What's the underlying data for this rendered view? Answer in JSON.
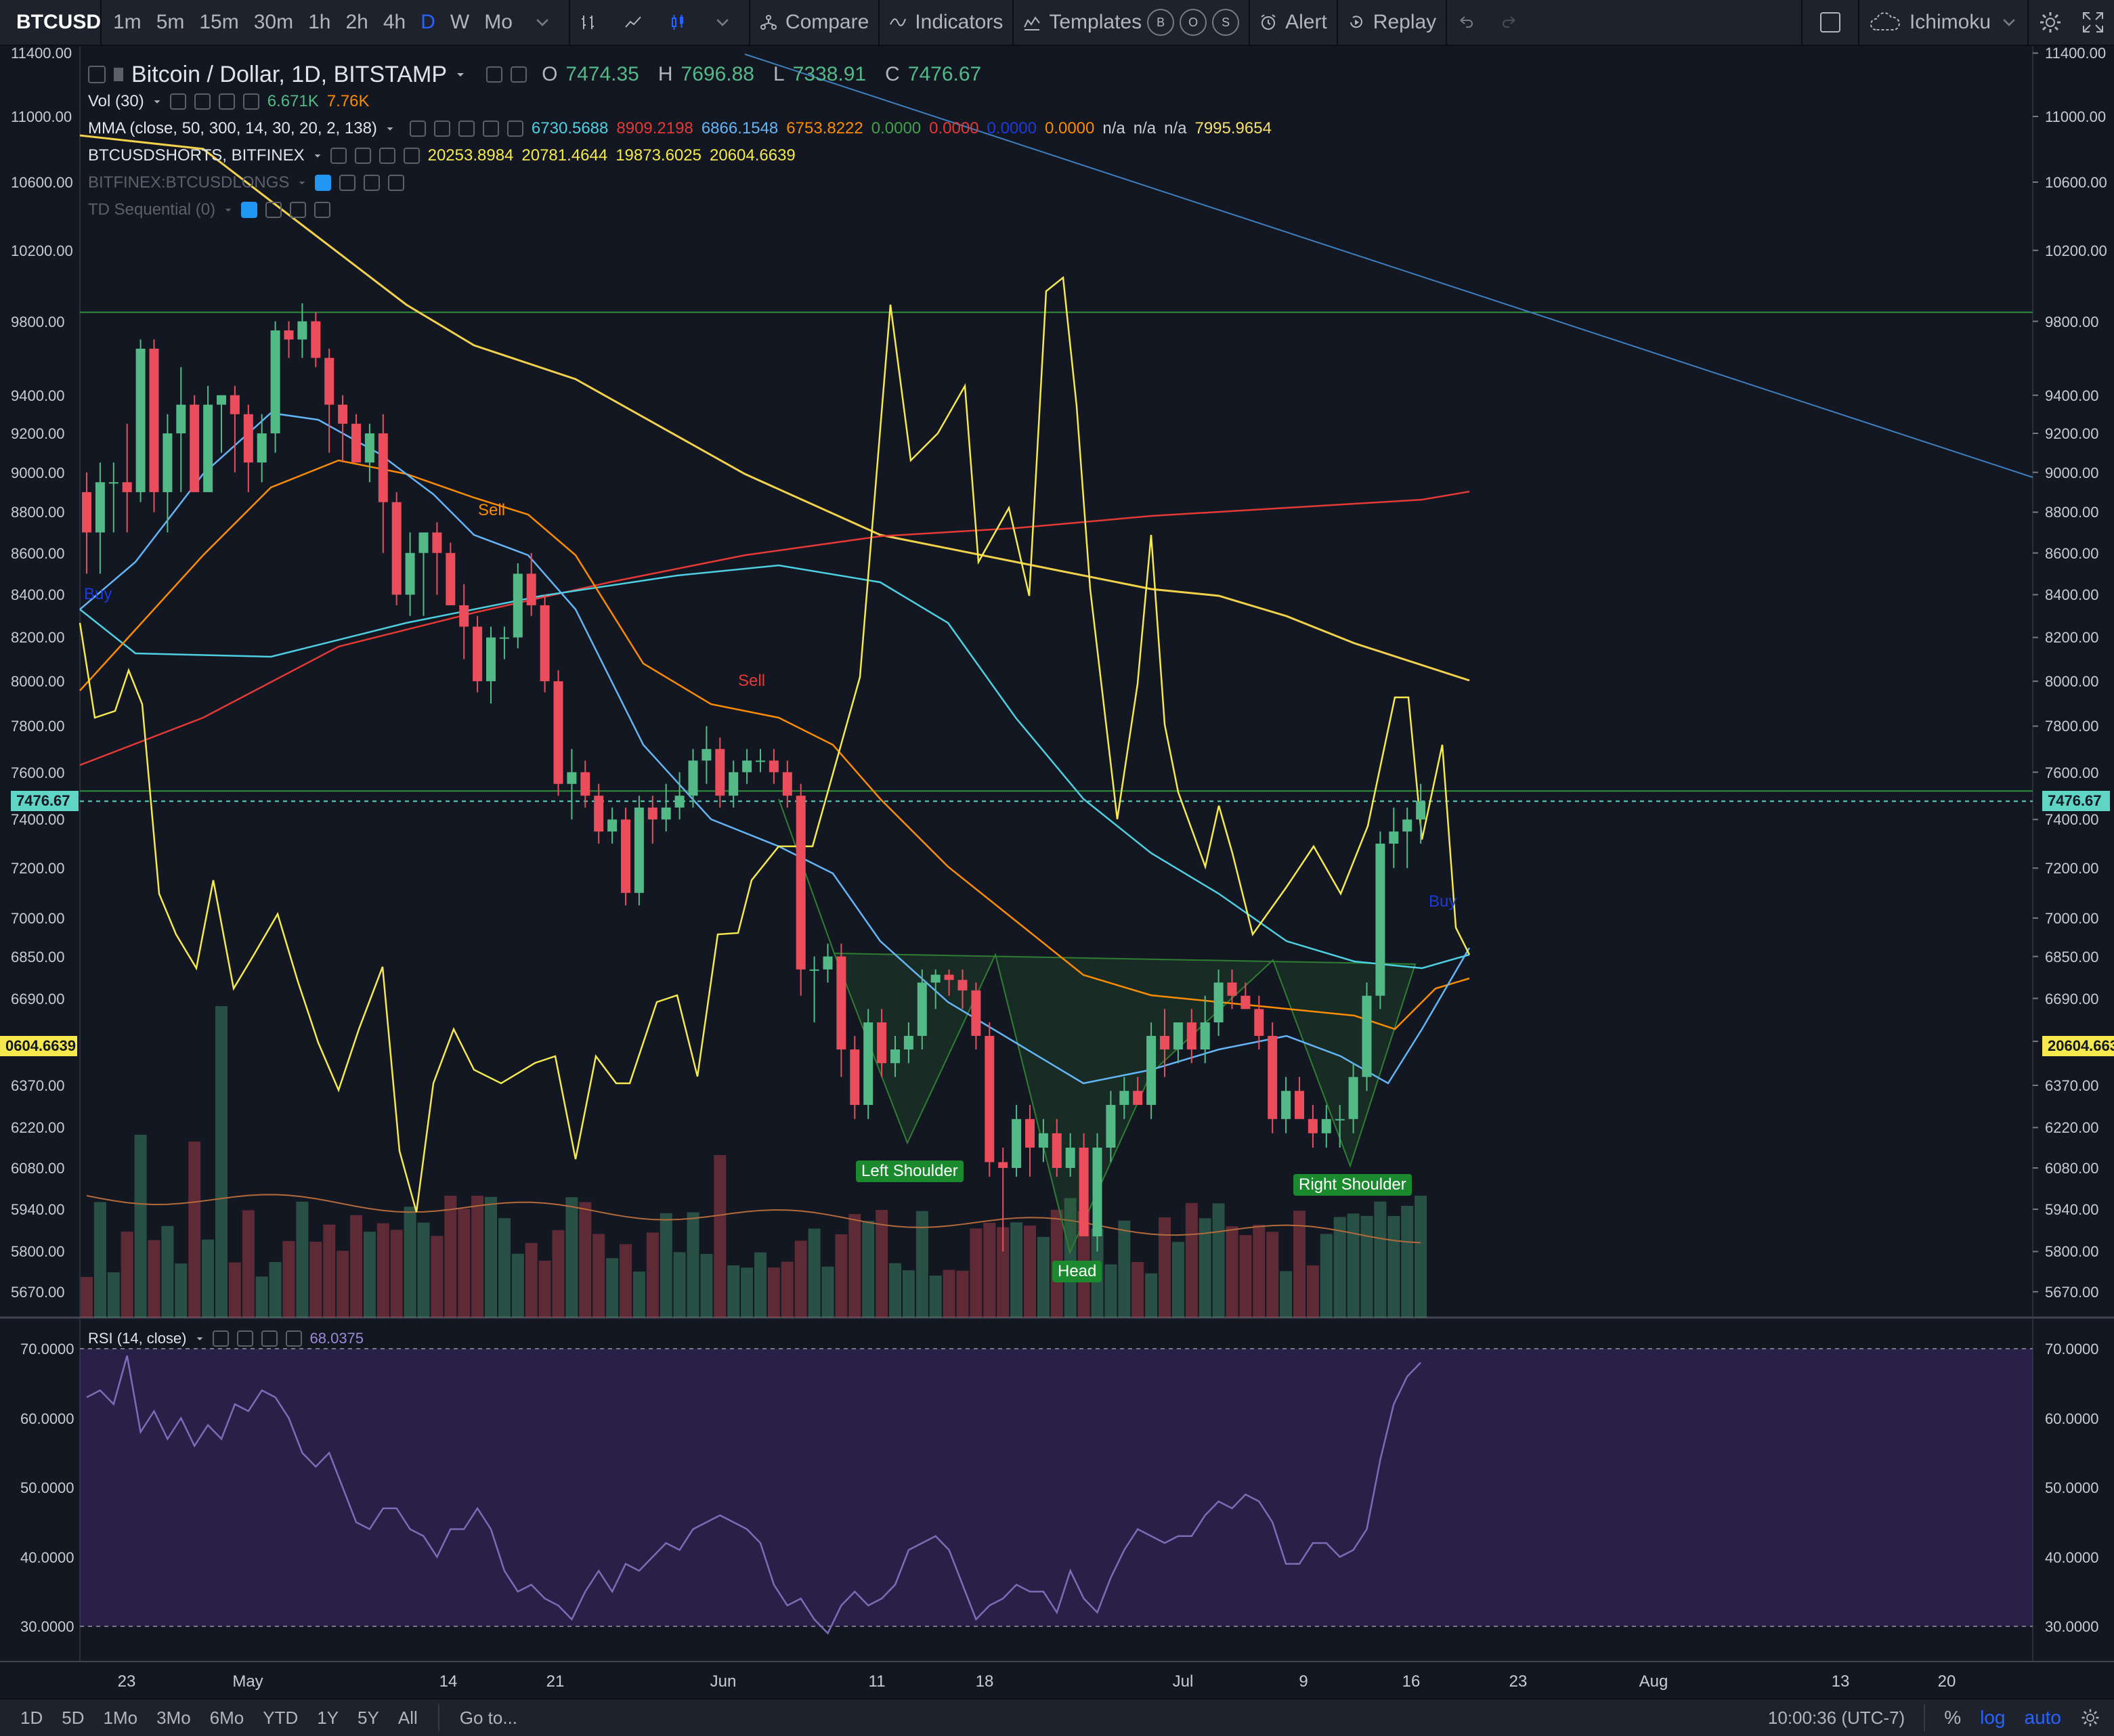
{
  "toolbar": {
    "symbol": "BTCUSD",
    "intervals": [
      "1m",
      "5m",
      "15m",
      "30m",
      "1h",
      "2h",
      "4h",
      "D",
      "W",
      "Mo"
    ],
    "active_interval": "D",
    "compare": "Compare",
    "indicators": "Indicators",
    "templates": "Templates",
    "badges": [
      "B",
      "O",
      "S"
    ],
    "alert": "Alert",
    "replay": "Replay",
    "layout_name": "Ichimoku"
  },
  "legend": {
    "title": "Bitcoin / Dollar, 1D, BITSTAMP",
    "open_k": "O",
    "open": "7474.35",
    "high_k": "H",
    "high": "7696.88",
    "low_k": "L",
    "low": "7338.91",
    "close_k": "C",
    "close": "7476.67",
    "vol_label": "Vol (30)",
    "vol_v1": "6.671K",
    "vol_v2": "7.76K",
    "mma_label": "MMA (close, 50, 300, 14, 30, 20, 2, 138)",
    "mma_values": [
      {
        "v": "6730.5688",
        "c": "#4dd0e1"
      },
      {
        "v": "8909.2198",
        "c": "#e53935"
      },
      {
        "v": "6866.1548",
        "c": "#64b5f6"
      },
      {
        "v": "6753.8222",
        "c": "#fb8c00"
      },
      {
        "v": "0.0000",
        "c": "#43a047"
      },
      {
        "v": "0.0000",
        "c": "#e53935"
      },
      {
        "v": "0.0000",
        "c": "#1e3ad8"
      },
      {
        "v": "0.0000",
        "c": "#fb8c00"
      },
      {
        "v": "n/a",
        "c": "#c8ccd4"
      },
      {
        "v": "n/a",
        "c": "#c8ccd4"
      },
      {
        "v": "n/a",
        "c": "#c8ccd4"
      },
      {
        "v": "7995.9654",
        "c": "#f5e06b"
      }
    ],
    "shorts_label": "BTCUSDSHORTS, BITFINEX",
    "shorts_values": [
      "20253.8984",
      "20781.4644",
      "19873.6025",
      "20604.6639"
    ],
    "longs_label": "BITFINEX:BTCUSDLONGS",
    "td_label": "TD Sequential (0)"
  },
  "price_axis": {
    "ticks": [
      "11400.00",
      "11000.00",
      "10600.00",
      "10200.00",
      "9800.00",
      "9400.00",
      "9200.00",
      "9000.00",
      "8800.00",
      "8600.00",
      "8400.00",
      "8200.00",
      "8000.00",
      "7800.00",
      "7600.00",
      "7400.00",
      "7200.00",
      "7000.00",
      "6850.00",
      "6690.00",
      "6530.00",
      "6370.00",
      "6220.00",
      "6080.00",
      "5940.00",
      "5800.00",
      "5670.00"
    ],
    "current_price": "7476.67",
    "shorts_price_tag": "20604.6639",
    "shorts_price_tag_left": "0604.6639"
  },
  "rsi": {
    "label": "RSI (14, close)",
    "value": "68.0375",
    "ticks": [
      "70.0000",
      "60.0000",
      "50.0000",
      "40.0000",
      "30.0000"
    ]
  },
  "time_axis": [
    "23",
    "May",
    "14",
    "21",
    "Jun",
    "11",
    "18",
    "Jul",
    "9",
    "16",
    "23",
    "Aug",
    "13",
    "20"
  ],
  "annotations": {
    "left_shoulder": "Left Shoulder",
    "head": "Head",
    "right_shoulder": "Right Shoulder",
    "sell1": "Sell",
    "sell2": "Sell",
    "buy1": "Buy",
    "buy2": "Buy"
  },
  "bottombar": {
    "ranges": [
      "1D",
      "5D",
      "1Mo",
      "3Mo",
      "6Mo",
      "YTD",
      "1Y",
      "5Y",
      "All"
    ],
    "goto": "Go to...",
    "time": "10:00:36 (UTC-7)",
    "percent": "%",
    "log": "log",
    "auto": "auto"
  },
  "colors": {
    "bg": "#131722",
    "up": "#53b987",
    "down": "#eb4d5c",
    "accent": "#2962ff"
  },
  "chart_data": {
    "type": "candlestick",
    "series": [
      {
        "name": "Bitcoin / Dollar, 1D, BITSTAMP",
        "values": [
          [
            8900,
            9000,
            8500,
            8700
          ],
          [
            8700,
            9050,
            8500,
            8950
          ],
          [
            8950,
            9050,
            8700,
            8950
          ],
          [
            8950,
            9250,
            8700,
            8900
          ],
          [
            8900,
            9700,
            8850,
            9650
          ],
          [
            9650,
            9700,
            8800,
            8900
          ],
          [
            8900,
            9300,
            8700,
            9200
          ],
          [
            9200,
            9550,
            8900,
            9350
          ],
          [
            9350,
            9400,
            8950,
            8900
          ],
          [
            8900,
            9450,
            8900,
            9350
          ],
          [
            9350,
            9400,
            9100,
            9400
          ],
          [
            9400,
            9450,
            9000,
            9300
          ],
          [
            9300,
            9350,
            8900,
            9050
          ],
          [
            9050,
            9300,
            8950,
            9200
          ],
          [
            9200,
            9800,
            9100,
            9750
          ],
          [
            9750,
            9800,
            9600,
            9700
          ],
          [
            9700,
            9900,
            9600,
            9800
          ],
          [
            9800,
            9850,
            9550,
            9600
          ],
          [
            9600,
            9650,
            9100,
            9350
          ],
          [
            9350,
            9400,
            9050,
            9250
          ],
          [
            9250,
            9300,
            9050,
            9050
          ],
          [
            9050,
            9250,
            8950,
            9200
          ],
          [
            9200,
            9300,
            8600,
            8850
          ],
          [
            8850,
            8900,
            8350,
            8400
          ],
          [
            8400,
            8700,
            8300,
            8600
          ],
          [
            8600,
            8700,
            8300,
            8700
          ],
          [
            8700,
            8750,
            8400,
            8600
          ],
          [
            8600,
            8650,
            8350,
            8350
          ],
          [
            8350,
            8450,
            8100,
            8250
          ],
          [
            8250,
            8300,
            7950,
            8000
          ],
          [
            8000,
            8250,
            7900,
            8200
          ],
          [
            8200,
            8250,
            8100,
            8200
          ],
          [
            8200,
            8550,
            8150,
            8500
          ],
          [
            8500,
            8600,
            8300,
            8350
          ],
          [
            8350,
            8400,
            7950,
            8000
          ],
          [
            8000,
            8050,
            7500,
            7550
          ],
          [
            7550,
            7700,
            7400,
            7600
          ],
          [
            7600,
            7650,
            7450,
            7500
          ],
          [
            7500,
            7550,
            7300,
            7350
          ],
          [
            7350,
            7450,
            7300,
            7400
          ],
          [
            7400,
            7450,
            7050,
            7100
          ],
          [
            7100,
            7500,
            7050,
            7450
          ],
          [
            7450,
            7500,
            7300,
            7400
          ],
          [
            7400,
            7550,
            7350,
            7450
          ],
          [
            7450,
            7600,
            7400,
            7500
          ],
          [
            7500,
            7700,
            7450,
            7650
          ],
          [
            7650,
            7800,
            7550,
            7700
          ],
          [
            7700,
            7750,
            7450,
            7500
          ],
          [
            7500,
            7650,
            7450,
            7600
          ],
          [
            7600,
            7700,
            7550,
            7650
          ],
          [
            7650,
            7700,
            7600,
            7650
          ],
          [
            7650,
            7700,
            7550,
            7600
          ],
          [
            7600,
            7650,
            7450,
            7500
          ],
          [
            7500,
            7550,
            6700,
            6800
          ],
          [
            6800,
            6850,
            6600,
            6800
          ],
          [
            6800,
            6900,
            6750,
            6850
          ],
          [
            6850,
            6900,
            6400,
            6500
          ],
          [
            6500,
            6550,
            6250,
            6300
          ],
          [
            6300,
            6650,
            6250,
            6600
          ],
          [
            6600,
            6650,
            6400,
            6450
          ],
          [
            6450,
            6550,
            6400,
            6500
          ],
          [
            6500,
            6600,
            6450,
            6550
          ],
          [
            6550,
            6800,
            6500,
            6750
          ],
          [
            6750,
            6800,
            6650,
            6780
          ],
          [
            6780,
            6800,
            6700,
            6760
          ],
          [
            6760,
            6800,
            6650,
            6720
          ],
          [
            6720,
            6750,
            6500,
            6550
          ],
          [
            6550,
            6600,
            6050,
            6100
          ],
          [
            6100,
            6150,
            5800,
            6080
          ],
          [
            6080,
            6300,
            6050,
            6250
          ],
          [
            6250,
            6300,
            6050,
            6150
          ],
          [
            6150,
            6250,
            6100,
            6200
          ],
          [
            6200,
            6250,
            6050,
            6080
          ],
          [
            6080,
            6200,
            6050,
            6150
          ],
          [
            6150,
            6200,
            5850,
            5850
          ],
          [
            5850,
            6200,
            5800,
            6150
          ],
          [
            6150,
            6350,
            6100,
            6300
          ],
          [
            6300,
            6400,
            6250,
            6350
          ],
          [
            6350,
            6400,
            6300,
            6300
          ],
          [
            6300,
            6600,
            6250,
            6550
          ],
          [
            6550,
            6650,
            6400,
            6500
          ],
          [
            6500,
            6600,
            6450,
            6600
          ],
          [
            6600,
            6650,
            6450,
            6500
          ],
          [
            6500,
            6700,
            6450,
            6600
          ],
          [
            6600,
            6800,
            6550,
            6750
          ],
          [
            6750,
            6800,
            6650,
            6700
          ],
          [
            6700,
            6750,
            6650,
            6650
          ],
          [
            6650,
            6700,
            6500,
            6550
          ],
          [
            6550,
            6600,
            6200,
            6250
          ],
          [
            6250,
            6400,
            6200,
            6350
          ],
          [
            6350,
            6400,
            6250,
            6250
          ],
          [
            6250,
            6300,
            6150,
            6200
          ],
          [
            6200,
            6300,
            6150,
            6250
          ],
          [
            6250,
            6300,
            6150,
            6250
          ],
          [
            6250,
            6450,
            6200,
            6400
          ],
          [
            6400,
            6750,
            6350,
            6700
          ],
          [
            6700,
            7350,
            6650,
            7300
          ],
          [
            7300,
            7450,
            7200,
            7350
          ],
          [
            7350,
            7450,
            7200,
            7400
          ],
          [
            7400,
            7550,
            7300,
            7476.67
          ]
        ]
      }
    ]
  }
}
